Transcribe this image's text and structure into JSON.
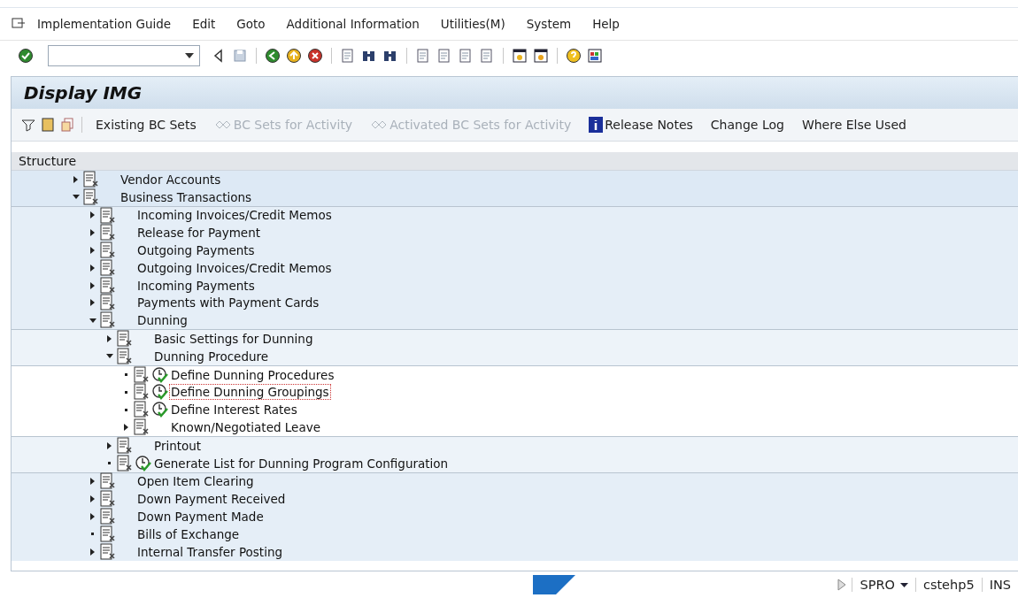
{
  "menu_bar": [
    "Implementation Guide",
    "Edit",
    "Goto",
    "Additional Information",
    "Utilities(M)",
    "System",
    "Help"
  ],
  "title": "Display IMG",
  "app_toolbar": [
    {
      "label": "Existing BC Sets",
      "disabled": false,
      "kind": "plain"
    },
    {
      "label": "BC Sets for Activity",
      "disabled": true,
      "kind": "bcset"
    },
    {
      "label": "Activated BC Sets for Activity",
      "disabled": true,
      "kind": "bcset"
    },
    {
      "label": "Release Notes",
      "disabled": false,
      "kind": "info"
    },
    {
      "label": "Change Log",
      "disabled": false,
      "kind": "plain"
    },
    {
      "label": "Where Else Used",
      "disabled": false,
      "kind": "plain"
    }
  ],
  "tree": {
    "header": "Structure",
    "items": [
      {
        "label": "Vendor Accounts",
        "kind": "branch",
        "expanded": false,
        "activity": false,
        "selected": false
      },
      {
        "label": "Business Transactions",
        "kind": "branch",
        "expanded": true,
        "activity": false,
        "selected": false,
        "children": [
          {
            "label": "Incoming Invoices/Credit Memos",
            "kind": "branch",
            "expanded": false,
            "activity": false,
            "selected": false
          },
          {
            "label": "Release for Payment",
            "kind": "branch",
            "expanded": false,
            "activity": false,
            "selected": false
          },
          {
            "label": "Outgoing Payments",
            "kind": "branch",
            "expanded": false,
            "activity": false,
            "selected": false
          },
          {
            "label": "Outgoing Invoices/Credit Memos",
            "kind": "branch",
            "expanded": false,
            "activity": false,
            "selected": false
          },
          {
            "label": "Incoming Payments",
            "kind": "branch",
            "expanded": false,
            "activity": false,
            "selected": false
          },
          {
            "label": "Payments with Payment Cards",
            "kind": "branch",
            "expanded": false,
            "activity": false,
            "selected": false
          },
          {
            "label": "Dunning",
            "kind": "branch",
            "expanded": true,
            "activity": false,
            "selected": false,
            "children": [
              {
                "label": "Basic Settings for Dunning",
                "kind": "branch",
                "expanded": false,
                "activity": false,
                "selected": false
              },
              {
                "label": "Dunning Procedure",
                "kind": "branch",
                "expanded": true,
                "activity": false,
                "selected": false,
                "children": [
                  {
                    "label": "Define Dunning Procedures",
                    "kind": "leaf",
                    "activity": true,
                    "selected": false
                  },
                  {
                    "label": "Define Dunning Groupings",
                    "kind": "leaf",
                    "activity": true,
                    "selected": true
                  },
                  {
                    "label": "Define Interest Rates",
                    "kind": "leaf",
                    "activity": true,
                    "selected": false
                  },
                  {
                    "label": "Known/Negotiated Leave",
                    "kind": "branch",
                    "expanded": false,
                    "activity": false,
                    "selected": false
                  }
                ]
              },
              {
                "label": "Printout",
                "kind": "branch",
                "expanded": false,
                "activity": false,
                "selected": false
              },
              {
                "label": "Generate List for Dunning Program Configuration",
                "kind": "leaf",
                "activity": true,
                "selected": false
              }
            ]
          },
          {
            "label": "Open Item Clearing",
            "kind": "branch",
            "expanded": false,
            "activity": false,
            "selected": false
          },
          {
            "label": "Down Payment Received",
            "kind": "branch",
            "expanded": false,
            "activity": false,
            "selected": false
          },
          {
            "label": "Down Payment Made",
            "kind": "branch",
            "expanded": false,
            "activity": false,
            "selected": false
          },
          {
            "label": "Bills of Exchange",
            "kind": "leaf",
            "activity": false,
            "selected": false
          },
          {
            "label": "Internal Transfer Posting",
            "kind": "branch",
            "expanded": false,
            "activity": false,
            "selected": false
          }
        ]
      }
    ]
  },
  "status_bar": {
    "transaction": "SPRO",
    "server": "cstehp5",
    "mode": "INS"
  }
}
